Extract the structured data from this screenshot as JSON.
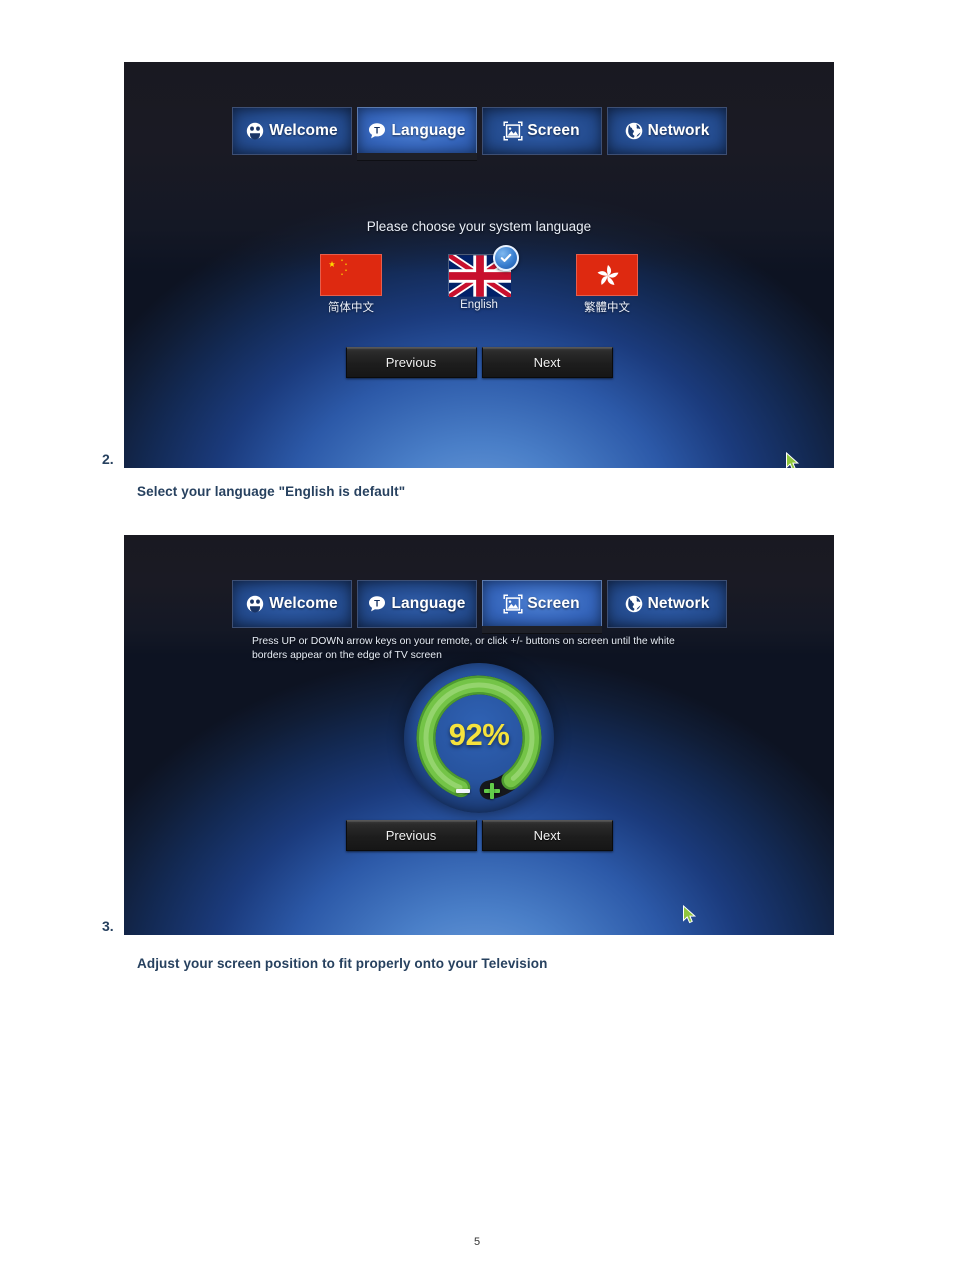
{
  "document": {
    "page_number": "5"
  },
  "steps": [
    {
      "number": "2.",
      "caption": "Select your language \"English is default\""
    },
    {
      "number": "3.",
      "caption": "Adjust your screen position to fit properly onto your Television"
    }
  ],
  "colors": {
    "caption_text": "#27415f",
    "gauge_value": "#f5e23c",
    "gauge_arc": "#74c447",
    "plus_button": "#62cc4a",
    "minus_button": "#f2f6fb",
    "cursor": "#8fc63d",
    "tab_active": "#3565bb",
    "flag_china_red": "#de2910",
    "flag_hk_red": "#de2910",
    "uk_blue": "#012169",
    "uk_red": "#c8102e"
  },
  "screens": [
    {
      "id": "language-screen",
      "tabs": [
        {
          "label": "Welcome",
          "icon": "smiley-icon",
          "active": false
        },
        {
          "label": "Language",
          "icon": "speech-bubble-icon",
          "active": true
        },
        {
          "label": "Screen",
          "icon": "picture-frame-icon",
          "active": false
        },
        {
          "label": "Network",
          "icon": "globe-icon",
          "active": false
        }
      ],
      "prompt": "Please choose your system language",
      "languages": [
        {
          "name": "简体中文",
          "flag": "china-flag",
          "selected": false
        },
        {
          "name": "English",
          "flag": "uk-flag",
          "selected": true
        },
        {
          "name": "繁體中文",
          "flag": "hongkong-flag",
          "selected": false
        }
      ],
      "buttons": {
        "previous": "Previous",
        "next": "Next"
      }
    },
    {
      "id": "screen-adjust-screen",
      "tabs": [
        {
          "label": "Welcome",
          "icon": "smiley-icon",
          "active": false
        },
        {
          "label": "Language",
          "icon": "speech-bubble-icon",
          "active": false
        },
        {
          "label": "Screen",
          "icon": "picture-frame-icon",
          "active": true
        },
        {
          "label": "Network",
          "icon": "globe-icon",
          "active": false
        }
      ],
      "instruction": "Press UP or DOWN arrow keys on your remote, or click +/- buttons on screen until the white borders appear on the edge of TV screen",
      "gauge": {
        "value": "92%",
        "percent": 92,
        "decrease_label": "−",
        "increase_label": "+"
      },
      "buttons": {
        "previous": "Previous",
        "next": "Next"
      }
    }
  ]
}
